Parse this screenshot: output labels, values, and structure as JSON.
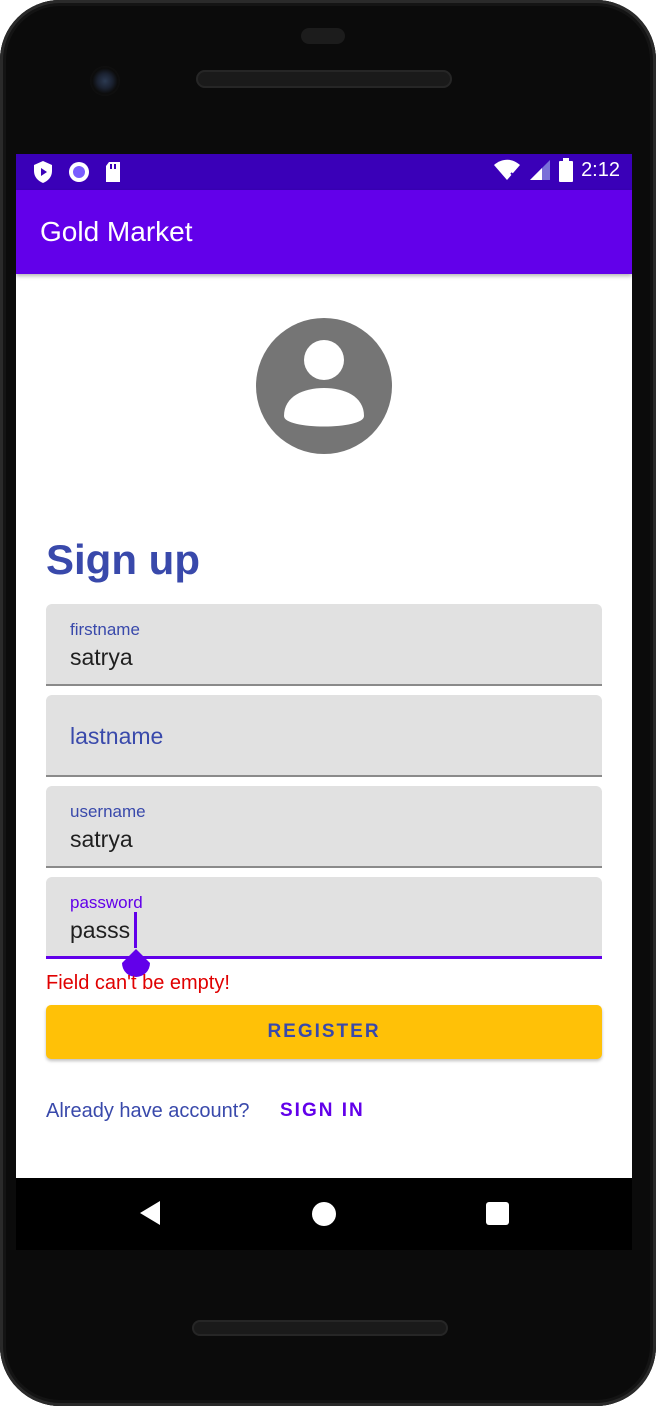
{
  "status_bar": {
    "time": "2:12",
    "left_icons": [
      "shield-play-icon",
      "record-icon",
      "sd-card-icon"
    ],
    "right_icons": [
      "wifi-icon",
      "signal-icon",
      "battery-icon"
    ]
  },
  "app_bar": {
    "title": "Gold Market"
  },
  "form": {
    "heading": "Sign up",
    "fields": [
      {
        "label": "firstname",
        "value": "satrya",
        "state": "filled"
      },
      {
        "label": "lastname",
        "value": "",
        "state": "empty"
      },
      {
        "label": "username",
        "value": "satrya",
        "state": "filled"
      },
      {
        "label": "password",
        "value": "passs",
        "state": "focused"
      }
    ],
    "error": "Field can't be empty!",
    "register_label": "REGISTER"
  },
  "footer": {
    "prompt": "Already have account?",
    "signin_label": "SIGN IN"
  },
  "colors": {
    "status_bar": "#3a00b8",
    "app_bar": "#6200ea",
    "accent": "#6200ea",
    "heading": "#3949ab",
    "button": "#ffc107",
    "error": "#e00000"
  },
  "nav_bar": {
    "buttons": [
      "back-icon",
      "home-icon",
      "recents-icon"
    ]
  }
}
